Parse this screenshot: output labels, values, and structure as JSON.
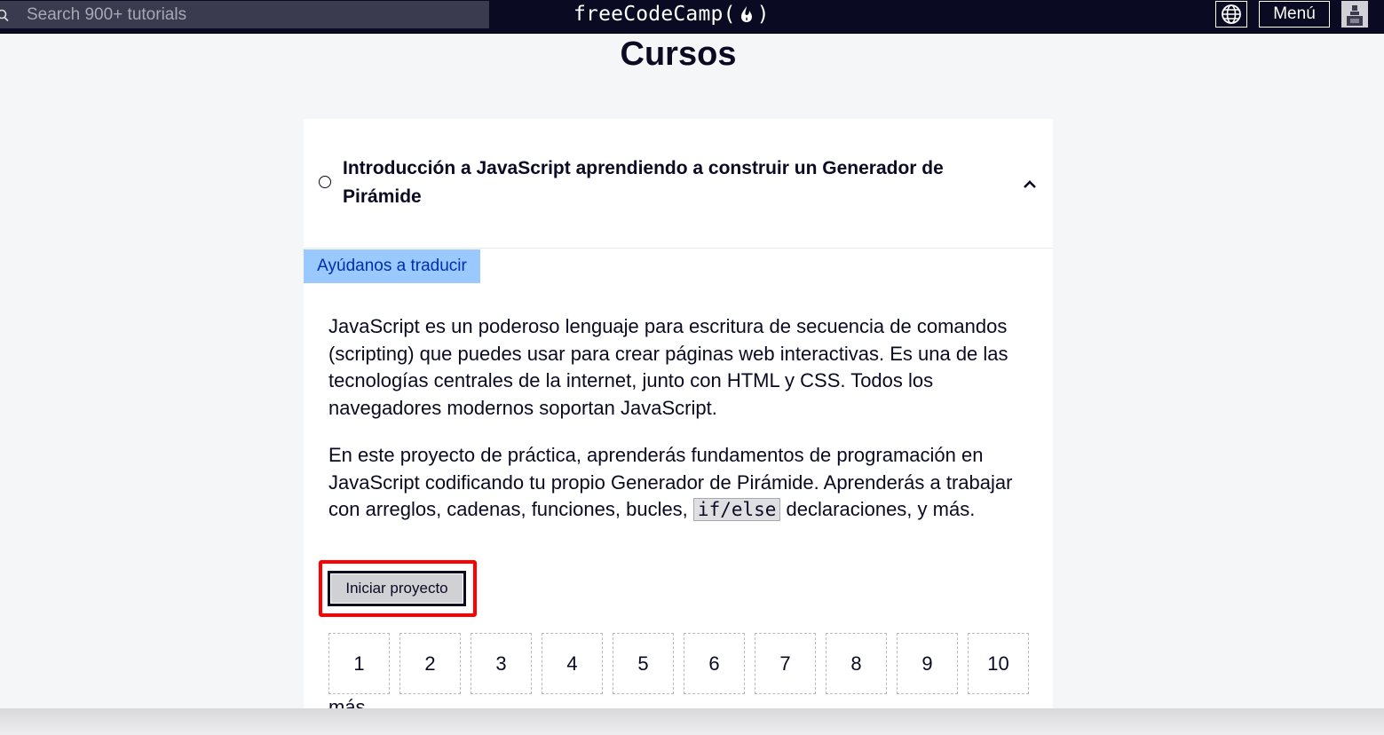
{
  "navbar": {
    "search_placeholder": "Search 900+ tutorials",
    "logo_text_left": "freeCodeCamp(",
    "logo_text_right": ")",
    "menu_label": "Menú"
  },
  "page": {
    "title": "Cursos"
  },
  "block": {
    "title": "Introducción a JavaScript aprendiendo a construir un Generador de Pirámide",
    "translate_link": "Ayúdanos a traducir",
    "description_1": "JavaScript es un poderoso lenguaje para escritura de secuencia de comandos (scripting) que puedes usar para crear páginas web interactivas. Es una de las tecnologías centrales de la internet, junto con HTML y CSS. Todos los navegadores modernos soportan JavaScript.",
    "description_2_before": "En este proyecto de práctica, aprenderás fundamentos de programación en JavaScript codificando tu propio Generador de Pirámide. Aprenderás a trabajar con arreglos, cadenas, funciones, bucles, ",
    "description_2_code": "if/else",
    "description_2_after": " declaraciones, y más.",
    "start_button": "Iniciar proyecto",
    "steps": [
      "1",
      "2",
      "3",
      "4",
      "5",
      "6",
      "7",
      "8",
      "9",
      "10"
    ],
    "overflow_text": "más."
  },
  "colors": {
    "navbar_bg": "#0a0a23",
    "search_bg": "#3b3b4f",
    "translate_bg": "#99c9ff",
    "highlight": "#ff0000"
  }
}
